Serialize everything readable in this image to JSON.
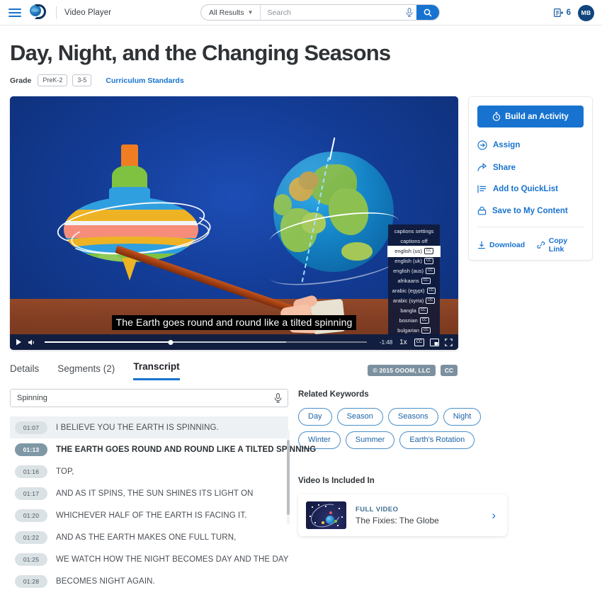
{
  "header": {
    "app_title": "Video Player",
    "menu_icon": "hamburger-icon",
    "logo_icon": "discovery-education-logo",
    "search": {
      "scope_label": "All Results",
      "placeholder": "Search",
      "value": "",
      "mic_icon": "microphone-icon",
      "submit_icon": "search-icon"
    },
    "quicklist": {
      "icon": "quicklist-icon",
      "count": "6"
    },
    "avatar_initials": "MB"
  },
  "page": {
    "title": "Day, Night, and the Changing Seasons",
    "grade_label": "Grade",
    "grade_chips": [
      "PreK-2",
      "3-5"
    ],
    "standards_link": "Curriculum Standards"
  },
  "video": {
    "caption_text": "The Earth goes round and round like a tilted spinning",
    "controls": {
      "play_icon": "play-icon",
      "volume_icon": "volume-icon",
      "time_remaining": "-1:48",
      "speed": "1x",
      "cc_label": "CC",
      "pip_icon": "picture-in-picture-icon",
      "fullscreen_icon": "fullscreen-icon"
    },
    "captions_menu": {
      "header": "captions settings",
      "off_label": "captions off",
      "selected": "english (us)",
      "options": [
        "english (us)",
        "english (uk)",
        "english (aus)",
        "afrikaans",
        "arabic (egypt)",
        "arabic (syria)",
        "bangla",
        "bosnian",
        "bulgarian"
      ],
      "cc_mark": "CC"
    }
  },
  "actions": {
    "primary": {
      "label": "Build an Activity",
      "icon": "stopwatch-icon"
    },
    "items": [
      {
        "label": "Assign",
        "icon": "assign-arrow-icon"
      },
      {
        "label": "Share",
        "icon": "share-icon"
      },
      {
        "label": "Add to QuickList",
        "icon": "quicklist-icon"
      },
      {
        "label": "Save to My Content",
        "icon": "lock-icon"
      }
    ],
    "download": {
      "label": "Download",
      "icon": "download-icon"
    },
    "copy_link": {
      "label": "Copy Link",
      "icon": "link-icon"
    }
  },
  "tabs": [
    {
      "label": "Details",
      "active": false
    },
    {
      "label": "Segments (2)",
      "active": false
    },
    {
      "label": "Transcript",
      "active": true
    }
  ],
  "badges": {
    "copyright": "© 2015 OOOM, LLC",
    "cc": "CC"
  },
  "transcript": {
    "search_value": "Spinning",
    "search_mic_icon": "microphone-icon",
    "rows": [
      {
        "time": "01:07",
        "text": "I BELIEVE YOU THE EARTH IS SPINNING.",
        "state": "highlight"
      },
      {
        "time": "01:13",
        "text": "THE EARTH GOES ROUND AND ROUND LIKE A TILTED SPINNING",
        "state": "active"
      },
      {
        "time": "01:16",
        "text": "TOP,",
        "state": ""
      },
      {
        "time": "01:17",
        "text": "AND AS IT SPINS, THE SUN SHINES ITS LIGHT ON",
        "state": ""
      },
      {
        "time": "01:20",
        "text": "WHICHEVER HALF OF THE EARTH IS FACING IT.",
        "state": ""
      },
      {
        "time": "01:22",
        "text": "AND AS THE EARTH MAKES ONE FULL TURN,",
        "state": ""
      },
      {
        "time": "01:25",
        "text": "WE WATCH HOW THE NIGHT BECOMES DAY AND THE DAY",
        "state": ""
      },
      {
        "time": "01:28",
        "text": "BECOMES NIGHT AGAIN.",
        "state": ""
      }
    ]
  },
  "sidebar": {
    "keywords_title": "Related Keywords",
    "keywords": [
      "Day",
      "Season",
      "Seasons",
      "Night",
      "Winter",
      "Summer",
      "Earth's Rotation"
    ],
    "included_title": "Video Is Included In",
    "included_card": {
      "kicker": "FULL VIDEO",
      "name": "The Fixies: The Globe",
      "chevron_icon": "chevron-right-icon"
    }
  },
  "colors": {
    "accent": "#1773cf",
    "link": "#1c63a8",
    "badge_gray": "#7c919f",
    "video_bg": "#133c96"
  }
}
